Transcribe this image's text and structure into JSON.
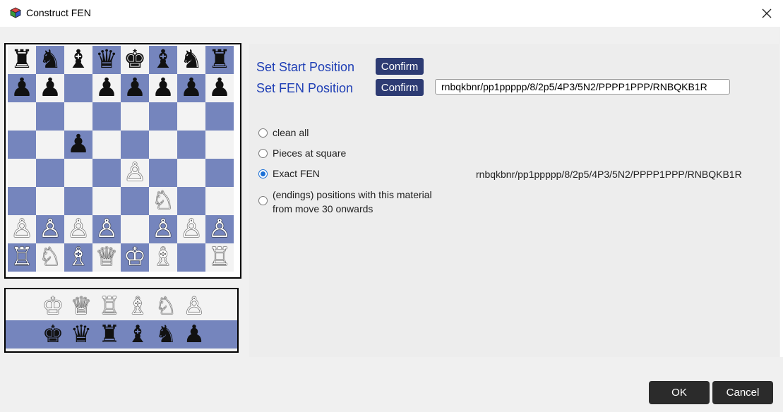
{
  "window": {
    "title": "Construct FEN",
    "app_icon": "cube-icon",
    "close_icon": "close-x-icon"
  },
  "colors": {
    "dark_square": "#7585bd",
    "light_square": "#f3f3f3",
    "link_text": "#1f3fb5",
    "confirm_button": "#2d3b73",
    "dialog_button": "#2b2b2b",
    "radio_selected": "#1a6fd6"
  },
  "board": {
    "rows": [
      [
        "♜",
        "♞",
        "♝",
        "♛",
        "♚",
        "♝",
        "♞",
        "♜"
      ],
      [
        "♟",
        "♟",
        "",
        "♟",
        "♟",
        "♟",
        "♟",
        "♟"
      ],
      [
        "",
        "",
        "",
        "",
        "",
        "",
        "",
        ""
      ],
      [
        "",
        "",
        "♟",
        "",
        "",
        "",
        "",
        ""
      ],
      [
        "",
        "",
        "",
        "",
        "♙",
        "",
        "",
        ""
      ],
      [
        "",
        "",
        "",
        "",
        "",
        "♘",
        "",
        ""
      ],
      [
        "♙",
        "♙",
        "♙",
        "♙",
        "",
        "♙",
        "♙",
        "♙"
      ],
      [
        "♖",
        "♘",
        "♗",
        "♕",
        "♔",
        "♗",
        "",
        "♖"
      ]
    ]
  },
  "palette": {
    "white_pieces": [
      "♔",
      "♕",
      "♖",
      "♗",
      "♘",
      "♙"
    ],
    "black_pieces": [
      "♚",
      "♛",
      "♜",
      "♝",
      "♞",
      "♟"
    ]
  },
  "actions": {
    "start_label": "Set Start Position",
    "fen_label": "Set FEN  Position",
    "confirm_label": "Confirm",
    "fen_value": "rnbqkbnr/pp1ppppp/8/2p5/4P3/5N2/PPPP1PPP/RNBQKB1R"
  },
  "options": [
    {
      "label": "clean all",
      "checked": false
    },
    {
      "label": "Pieces at square",
      "checked": false
    },
    {
      "label": "Exact FEN",
      "checked": true
    },
    {
      "label": "(endings) positions with this material\nfrom move 30 onwards",
      "checked": false
    }
  ],
  "exact_fen_display": "rnbqkbnr/pp1ppppp/8/2p5/4P3/5N2/PPPP1PPP/RNBQKB1R",
  "footer": {
    "ok_label": "OK",
    "cancel_label": "Cancel"
  }
}
